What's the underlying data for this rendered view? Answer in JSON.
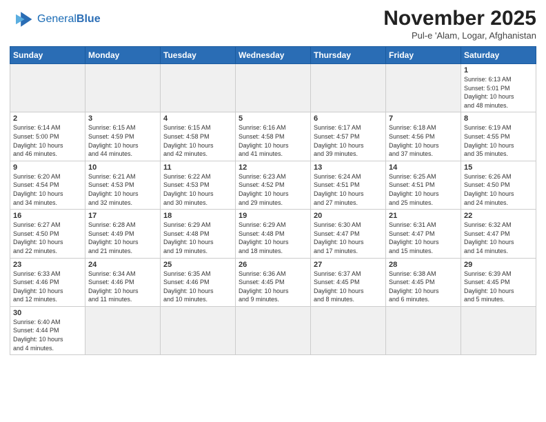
{
  "header": {
    "logo_general": "General",
    "logo_blue": "Blue",
    "title": "November 2025",
    "subtitle": "Pul-e 'Alam, Logar, Afghanistan"
  },
  "weekdays": [
    "Sunday",
    "Monday",
    "Tuesday",
    "Wednesday",
    "Thursday",
    "Friday",
    "Saturday"
  ],
  "weeks": [
    [
      {
        "day": "",
        "info": "",
        "empty": true
      },
      {
        "day": "",
        "info": "",
        "empty": true
      },
      {
        "day": "",
        "info": "",
        "empty": true
      },
      {
        "day": "",
        "info": "",
        "empty": true
      },
      {
        "day": "",
        "info": "",
        "empty": true
      },
      {
        "day": "",
        "info": "",
        "empty": true
      },
      {
        "day": "1",
        "info": "Sunrise: 6:13 AM\nSunset: 5:01 PM\nDaylight: 10 hours\nand 48 minutes."
      }
    ],
    [
      {
        "day": "2",
        "info": "Sunrise: 6:14 AM\nSunset: 5:00 PM\nDaylight: 10 hours\nand 46 minutes."
      },
      {
        "day": "3",
        "info": "Sunrise: 6:15 AM\nSunset: 4:59 PM\nDaylight: 10 hours\nand 44 minutes."
      },
      {
        "day": "4",
        "info": "Sunrise: 6:15 AM\nSunset: 4:58 PM\nDaylight: 10 hours\nand 42 minutes."
      },
      {
        "day": "5",
        "info": "Sunrise: 6:16 AM\nSunset: 4:58 PM\nDaylight: 10 hours\nand 41 minutes."
      },
      {
        "day": "6",
        "info": "Sunrise: 6:17 AM\nSunset: 4:57 PM\nDaylight: 10 hours\nand 39 minutes."
      },
      {
        "day": "7",
        "info": "Sunrise: 6:18 AM\nSunset: 4:56 PM\nDaylight: 10 hours\nand 37 minutes."
      },
      {
        "day": "8",
        "info": "Sunrise: 6:19 AM\nSunset: 4:55 PM\nDaylight: 10 hours\nand 35 minutes."
      }
    ],
    [
      {
        "day": "9",
        "info": "Sunrise: 6:20 AM\nSunset: 4:54 PM\nDaylight: 10 hours\nand 34 minutes."
      },
      {
        "day": "10",
        "info": "Sunrise: 6:21 AM\nSunset: 4:53 PM\nDaylight: 10 hours\nand 32 minutes."
      },
      {
        "day": "11",
        "info": "Sunrise: 6:22 AM\nSunset: 4:53 PM\nDaylight: 10 hours\nand 30 minutes."
      },
      {
        "day": "12",
        "info": "Sunrise: 6:23 AM\nSunset: 4:52 PM\nDaylight: 10 hours\nand 29 minutes."
      },
      {
        "day": "13",
        "info": "Sunrise: 6:24 AM\nSunset: 4:51 PM\nDaylight: 10 hours\nand 27 minutes."
      },
      {
        "day": "14",
        "info": "Sunrise: 6:25 AM\nSunset: 4:51 PM\nDaylight: 10 hours\nand 25 minutes."
      },
      {
        "day": "15",
        "info": "Sunrise: 6:26 AM\nSunset: 4:50 PM\nDaylight: 10 hours\nand 24 minutes."
      }
    ],
    [
      {
        "day": "16",
        "info": "Sunrise: 6:27 AM\nSunset: 4:50 PM\nDaylight: 10 hours\nand 22 minutes."
      },
      {
        "day": "17",
        "info": "Sunrise: 6:28 AM\nSunset: 4:49 PM\nDaylight: 10 hours\nand 21 minutes."
      },
      {
        "day": "18",
        "info": "Sunrise: 6:29 AM\nSunset: 4:48 PM\nDaylight: 10 hours\nand 19 minutes."
      },
      {
        "day": "19",
        "info": "Sunrise: 6:29 AM\nSunset: 4:48 PM\nDaylight: 10 hours\nand 18 minutes."
      },
      {
        "day": "20",
        "info": "Sunrise: 6:30 AM\nSunset: 4:47 PM\nDaylight: 10 hours\nand 17 minutes."
      },
      {
        "day": "21",
        "info": "Sunrise: 6:31 AM\nSunset: 4:47 PM\nDaylight: 10 hours\nand 15 minutes."
      },
      {
        "day": "22",
        "info": "Sunrise: 6:32 AM\nSunset: 4:47 PM\nDaylight: 10 hours\nand 14 minutes."
      }
    ],
    [
      {
        "day": "23",
        "info": "Sunrise: 6:33 AM\nSunset: 4:46 PM\nDaylight: 10 hours\nand 12 minutes."
      },
      {
        "day": "24",
        "info": "Sunrise: 6:34 AM\nSunset: 4:46 PM\nDaylight: 10 hours\nand 11 minutes."
      },
      {
        "day": "25",
        "info": "Sunrise: 6:35 AM\nSunset: 4:46 PM\nDaylight: 10 hours\nand 10 minutes."
      },
      {
        "day": "26",
        "info": "Sunrise: 6:36 AM\nSunset: 4:45 PM\nDaylight: 10 hours\nand 9 minutes."
      },
      {
        "day": "27",
        "info": "Sunrise: 6:37 AM\nSunset: 4:45 PM\nDaylight: 10 hours\nand 8 minutes."
      },
      {
        "day": "28",
        "info": "Sunrise: 6:38 AM\nSunset: 4:45 PM\nDaylight: 10 hours\nand 6 minutes."
      },
      {
        "day": "29",
        "info": "Sunrise: 6:39 AM\nSunset: 4:45 PM\nDaylight: 10 hours\nand 5 minutes."
      }
    ],
    [
      {
        "day": "30",
        "info": "Sunrise: 6:40 AM\nSunset: 4:44 PM\nDaylight: 10 hours\nand 4 minutes."
      },
      {
        "day": "",
        "info": "",
        "empty": true
      },
      {
        "day": "",
        "info": "",
        "empty": true
      },
      {
        "day": "",
        "info": "",
        "empty": true
      },
      {
        "day": "",
        "info": "",
        "empty": true
      },
      {
        "day": "",
        "info": "",
        "empty": true
      },
      {
        "day": "",
        "info": "",
        "empty": true
      }
    ]
  ]
}
